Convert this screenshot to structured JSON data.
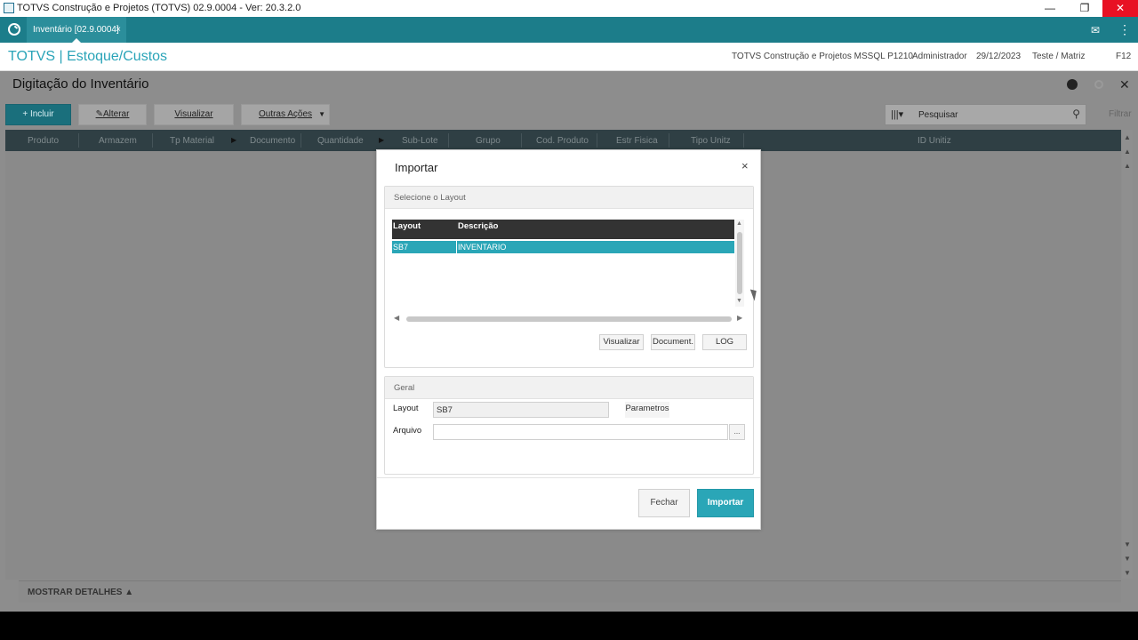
{
  "window": {
    "title": "TOTVS Construção e Projetos (TOTVS) 02.9.0004 - Ver: 20.3.2.0",
    "controls": {
      "minimize": "—",
      "restore": "❐",
      "close": "✕"
    }
  },
  "tabbar": {
    "tab_label": "Inventário [02.9.0004]",
    "tab_close": "×",
    "mail_icon": "✉",
    "menu_icon": "⋮"
  },
  "header": {
    "brand": "TOTVS | Estoque/Custos",
    "company": "TOTVS Construção e Projetos MSSQL P1210",
    "user": "Administrador",
    "date": "29/12/2023",
    "branch": "Teste / Matriz",
    "shortcut": "F12"
  },
  "page": {
    "title": "Digitação do Inventário",
    "close": "✕"
  },
  "toolbar": {
    "incluir": "+ Incluir",
    "alterar": "Alterar",
    "visualizar": "Visualizar",
    "outras_acoes": "Outras Ações",
    "search_placeholder": "Pesquisar",
    "filtrar": "Filtrar"
  },
  "grid": {
    "columns": [
      "Produto",
      "Armazem",
      "Tp Material",
      "Documento",
      "Quantidade",
      "Sub-Lote",
      "Grupo",
      "Cod. Produto",
      "Estr Fisica",
      "Tipo Unitz",
      "ID Unitiz"
    ]
  },
  "details": {
    "label": "MOSTRAR DETALHES ▲"
  },
  "dialog": {
    "title": "Importar",
    "close": "×",
    "layout_section": {
      "title": "Selecione o Layout",
      "columns": [
        "Layout",
        "Descrição"
      ],
      "rows": [
        {
          "layout": "SB7",
          "descricao": "INVENTARIO"
        }
      ],
      "buttons": {
        "visualizar": "Visualizar",
        "document": "Document.",
        "log": "LOG"
      }
    },
    "geral_section": {
      "title": "Geral",
      "layout_label": "Layout",
      "layout_value": "SB7",
      "parametros": "Parametros",
      "arquivo_label": "Arquivo",
      "arquivo_value": "",
      "browse": "..."
    },
    "footer": {
      "fechar": "Fechar",
      "importar": "Importar"
    }
  },
  "colors": {
    "brand_teal": "#1c7d8a",
    "accent": "#2aa6b7",
    "overlay": "#8d8d8d"
  }
}
